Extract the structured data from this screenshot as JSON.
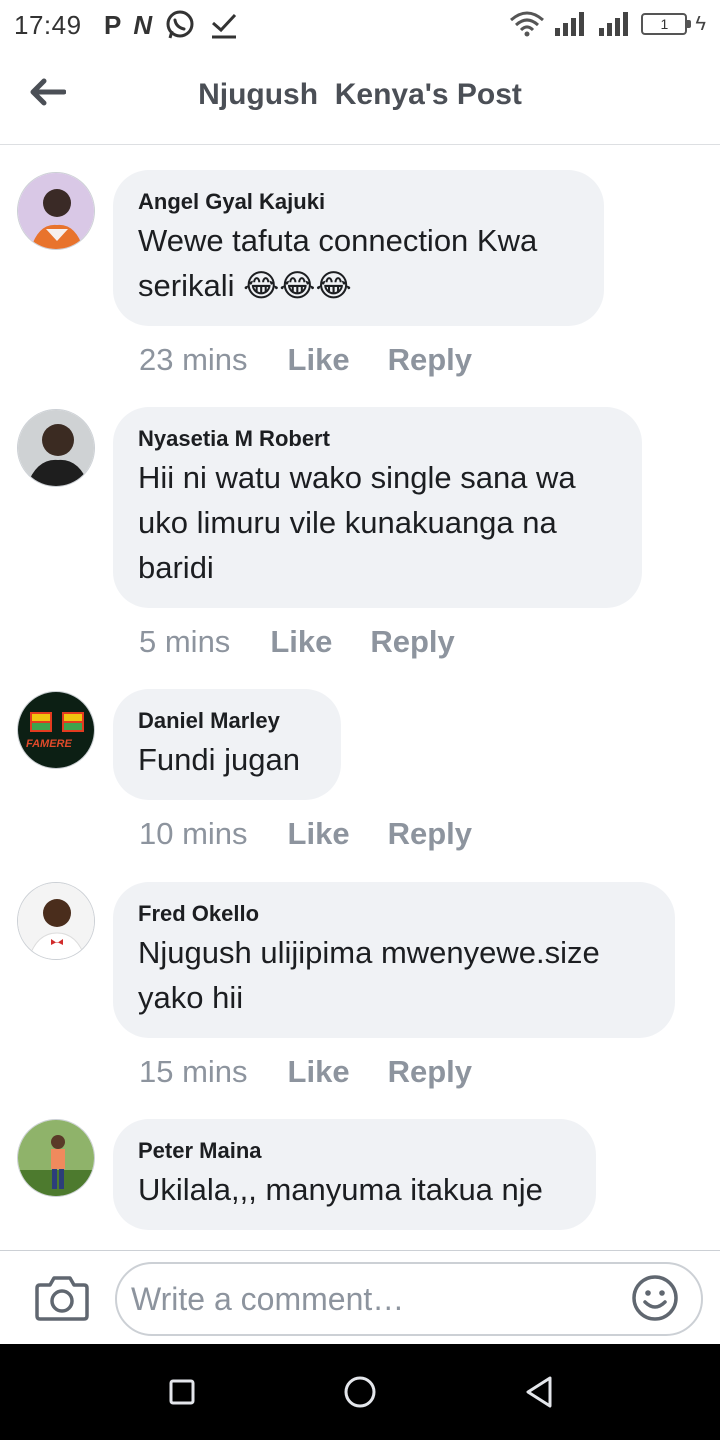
{
  "status_bar": {
    "time": "17:49",
    "left_glyphs": [
      "P",
      "N"
    ],
    "battery_level": "1",
    "bolt": "ϟ"
  },
  "header": {
    "title": "Njugush  Kenya's Post"
  },
  "comments": [
    {
      "author": "Angel Gyal Kajuki",
      "text": "Wewe tafuta connection Kwa serikali 😂😂😂",
      "time": "23 mins",
      "like": "Like",
      "reply": "Reply"
    },
    {
      "author": "Nyasetia M Robert",
      "text": "Hii ni watu wako single sana wa uko limuru vile kunakuanga na baridi",
      "time": "5 mins",
      "like": "Like",
      "reply": "Reply"
    },
    {
      "author": "Daniel Marley",
      "text": "Fundi jugan",
      "time": "10 mins",
      "like": "Like",
      "reply": "Reply",
      "avatar_text": "FAMERE"
    },
    {
      "author": "Fred Okello",
      "text": "Njugush ulijipima mwenyewe.size yako hii",
      "time": "15 mins",
      "like": "Like",
      "reply": "Reply"
    },
    {
      "author": "Peter Maina",
      "text": "Ukilala,,, manyuma itakua nje"
    }
  ],
  "compose": {
    "placeholder": "Write a comment…"
  },
  "colors": {
    "bubble": "#f0f2f5",
    "meta_text": "#8d949e",
    "title_text": "#4b4f56"
  }
}
